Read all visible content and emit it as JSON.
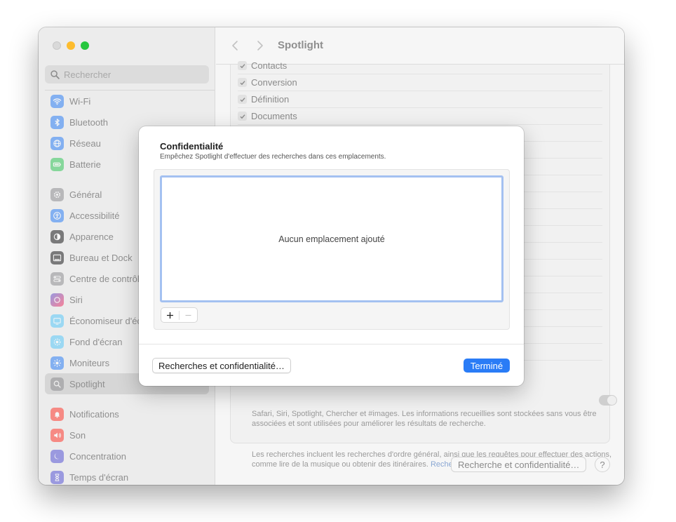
{
  "sidebar": {
    "search_placeholder": "Rechercher",
    "items": [
      {
        "label": "Wi-Fi",
        "icon": "wifi-icon",
        "color": "#2f80f6"
      },
      {
        "label": "Bluetooth",
        "icon": "bluetooth-icon",
        "color": "#2f80f6"
      },
      {
        "label": "Réseau",
        "icon": "globe-icon",
        "color": "#2f80f6"
      },
      {
        "label": "Batterie",
        "icon": "battery-icon",
        "color": "#34c759"
      },
      {
        "label": "Général",
        "icon": "gear-icon",
        "color": "#8e8e93"
      },
      {
        "label": "Accessibilité",
        "icon": "accessibility-icon",
        "color": "#2f80f6"
      },
      {
        "label": "Apparence",
        "icon": "appearance-icon",
        "color": "#1c1c1e"
      },
      {
        "label": "Bureau et Dock",
        "icon": "dock-icon",
        "color": "#1c1c1e"
      },
      {
        "label": "Centre de contrôle",
        "icon": "control-center-icon",
        "color": "#8e8e93"
      },
      {
        "label": "Siri",
        "icon": "siri-icon",
        "color": "#5856d6"
      },
      {
        "label": "Économiseur d'écran",
        "icon": "screensaver-icon",
        "color": "#5ac8fa"
      },
      {
        "label": "Fond d'écran",
        "icon": "wallpaper-icon",
        "color": "#5ac8fa"
      },
      {
        "label": "Moniteurs",
        "icon": "display-icon",
        "color": "#2f80f6"
      },
      {
        "label": "Spotlight",
        "icon": "spotlight-search-icon",
        "color": "#8e8e93"
      },
      {
        "label": "Notifications",
        "icon": "bell-icon",
        "color": "#ff3b30"
      },
      {
        "label": "Son",
        "icon": "speaker-icon",
        "color": "#ff3b30"
      },
      {
        "label": "Concentration",
        "icon": "moon-icon",
        "color": "#5856d6"
      },
      {
        "label": "Temps d'écran",
        "icon": "hourglass-icon",
        "color": "#5856d6"
      }
    ]
  },
  "main": {
    "title": "Spotlight",
    "categories": [
      "Contacts",
      "Conversion",
      "Définition",
      "Documents"
    ],
    "info_text_1": "Safari, Siri, Spotlight, Chercher et #images. Les informations recueillies sont stockées sans vous être associées et sont utilisées pour améliorer les résultats de recherche.",
    "info_text_2": "Les recherches incluent les recherches d'ordre général, ainsi que les requêtes pour effectuer des actions, comme lire de la musique ou obtenir des itinéraires.",
    "info_link": "Recherches et confidentialité…",
    "bottom_button": "Recherche et confidentialité…",
    "help_label": "?"
  },
  "dialog": {
    "title": "Confidentialité",
    "subtitle": "Empêchez Spotlight d'effectuer des recherches dans ces emplacements.",
    "empty_text": "Aucun emplacement ajouté",
    "privacy_button": "Recherches et confidentialité…",
    "done_button": "Terminé"
  },
  "colors": {
    "accent": "#2a7cf6",
    "focus_ring": "#a4c1f1"
  }
}
